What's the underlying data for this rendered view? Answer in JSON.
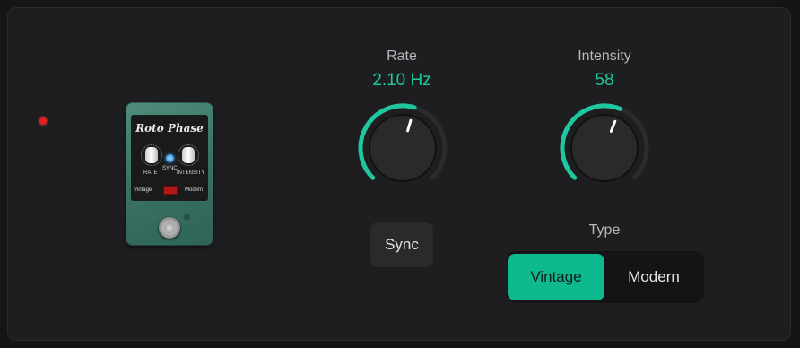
{
  "pedal": {
    "title": "Roto Phase",
    "rate_label": "RATE",
    "sync_label": "SYNC",
    "intensity_label": "INTENSITY",
    "vintage_label": "Vintage",
    "modern_label": "Modern"
  },
  "rate": {
    "label": "Rate",
    "value": "2.10 Hz",
    "level": 0.56
  },
  "intensity": {
    "label": "Intensity",
    "value": "58",
    "level": 0.58
  },
  "sync": {
    "label": "Sync"
  },
  "type": {
    "label": "Type",
    "options": [
      "Vintage",
      "Modern"
    ],
    "selected": "Vintage"
  },
  "colors": {
    "accent": "#1fc7a0",
    "track": "#2b2b2e",
    "knob": "#2a2a2c"
  }
}
